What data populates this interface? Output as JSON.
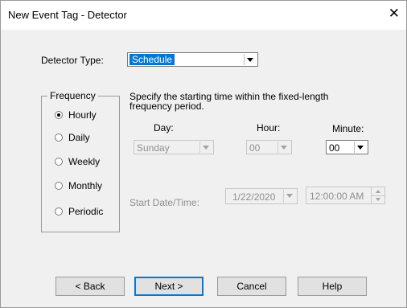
{
  "window": {
    "title": "New Event Tag - Detector",
    "close_glyph": "✕"
  },
  "detector": {
    "label": "Detector Type:",
    "value": "Schedule"
  },
  "frequency": {
    "group_label": "Frequency",
    "options": [
      {
        "label": "Hourly",
        "selected": true
      },
      {
        "label": "Daily",
        "selected": false
      },
      {
        "label": "Weekly",
        "selected": false
      },
      {
        "label": "Monthly",
        "selected": false
      },
      {
        "label": "Periodic",
        "selected": false
      }
    ]
  },
  "schedule": {
    "description_line1": "Specify the starting time within the fixed-length",
    "description_line2": "frequency period.",
    "day": {
      "label": "Day:",
      "value": "Sunday"
    },
    "hour": {
      "label": "Hour:",
      "value": "00"
    },
    "minute": {
      "label": "Minute:",
      "value": "00"
    },
    "start": {
      "label": "Start Date/Time:",
      "date": "1/22/2020",
      "time": "12:00:00 AM"
    }
  },
  "buttons": {
    "back": "< Back",
    "next": "Next >",
    "cancel": "Cancel",
    "help": "Help"
  },
  "colors": {
    "selection": "#0078d7",
    "disabled_text": "#8e8e8e",
    "dialog_bg": "#f0f0f0"
  }
}
